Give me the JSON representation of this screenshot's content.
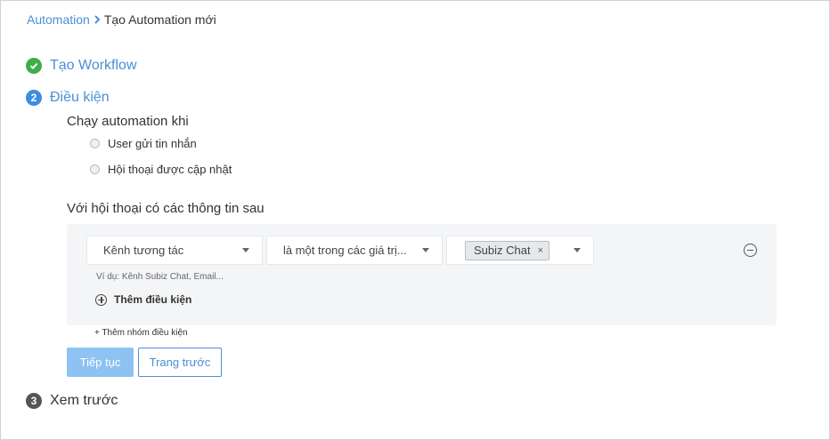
{
  "breadcrumb": {
    "parent": "Automation",
    "current": "Tạo Automation mới"
  },
  "steps": [
    {
      "number": "",
      "label": "Tạo Workflow",
      "state": "done"
    },
    {
      "number": "2",
      "label": "Điều kiện",
      "state": "active"
    },
    {
      "number": "3",
      "label": "Xem trước",
      "state": "pending"
    }
  ],
  "trigger": {
    "title": "Chạy automation khi",
    "options": [
      "User gửi tin nhắn",
      "Hội thoại được cập nhật"
    ]
  },
  "conditions": {
    "title": "Với hội thoại có các thông tin sau",
    "field_select": "Kênh tương tác",
    "operator_select": "là một trong các giá trị...",
    "value_tag": "Subiz Chat",
    "tag_remove": "×",
    "hint": "Ví dụ: Kênh Subiz Chat, Email...",
    "add_condition": "Thêm điều kiện",
    "add_group": "+ Thêm nhóm điều kiện"
  },
  "buttons": {
    "continue": "Tiếp tục",
    "previous": "Trang trước"
  },
  "colors": {
    "accent": "#4a8fd6",
    "success": "#3fae48",
    "primary_button": "#8ec2f2"
  }
}
